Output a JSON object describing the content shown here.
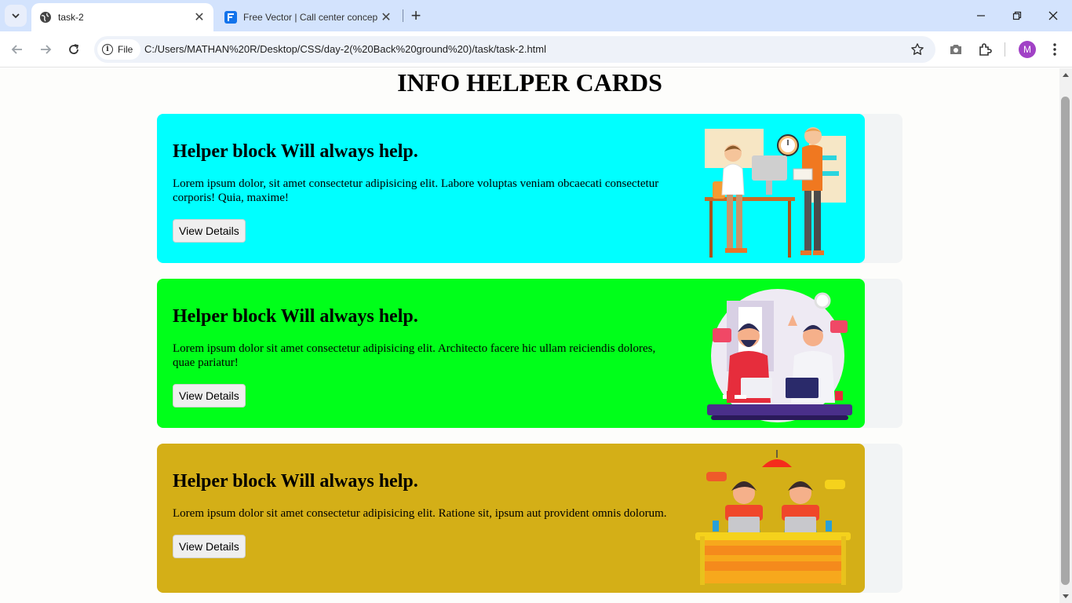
{
  "browser": {
    "tabs": [
      {
        "title": "task-2",
        "active": true
      },
      {
        "title": "Free Vector | Call center concep",
        "active": false
      }
    ],
    "address_chip": "File",
    "url": "C:/Users/MATHAN%20R/Desktop/CSS/day-2(%20Back%20ground%20)/task/task-2.html",
    "profile_initial": "M"
  },
  "page": {
    "title": "INFO HELPER CARDS",
    "cards": [
      {
        "heading": "Helper block Will always help.",
        "body": "Lorem ipsum dolor, sit amet consectetur adipisicing elit. Labore voluptas veniam obcaecati consectetur corporis! Quia, maxime!",
        "button": "View Details",
        "color": "#00ffff",
        "illustration": "office-desk-illustration"
      },
      {
        "heading": "Helper block Will always help.",
        "body": "Lorem ipsum dolor sit amet consectetur adipisicing elit. Architecto facere hic ullam reiciendis dolores, quae pariatur!",
        "button": "View Details",
        "color": "#00ff1a",
        "illustration": "support-agents-illustration"
      },
      {
        "heading": "Helper block Will always help.",
        "body": "Lorem ipsum dolor sit amet consectetur adipisicing elit. Ratione sit, ipsum aut provident omnis dolorum.",
        "button": "View Details",
        "color": "#d4af17",
        "illustration": "call-center-illustration"
      }
    ]
  }
}
